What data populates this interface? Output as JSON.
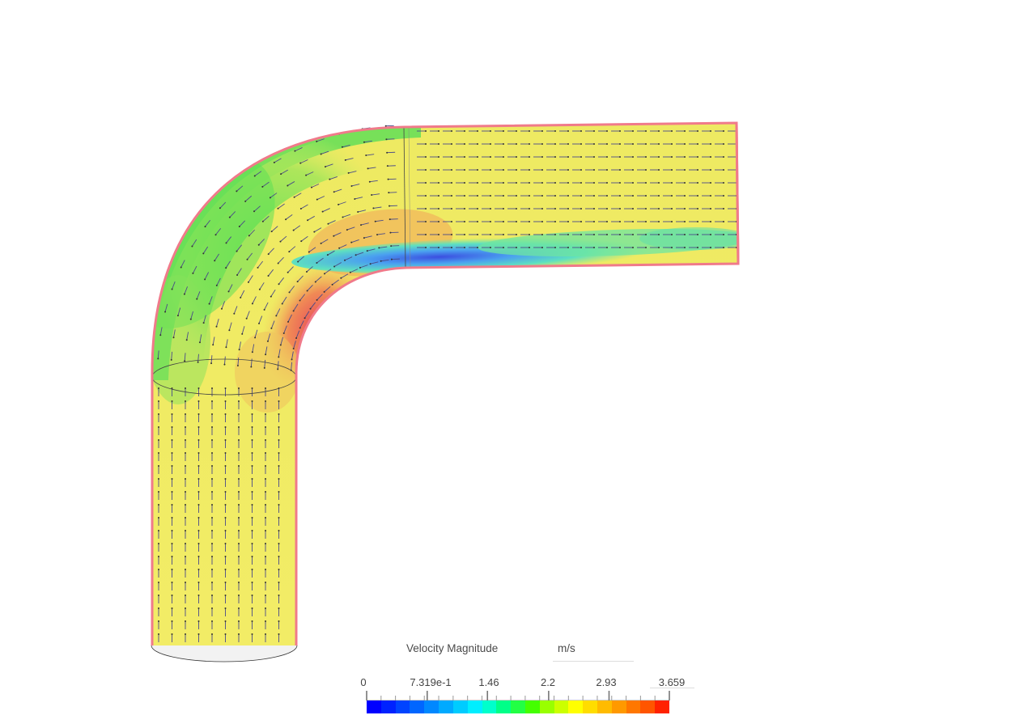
{
  "scene": {
    "field": "Velocity Magnitude",
    "object": "pipe-elbow-90deg",
    "contour_colors": {
      "bulk": "#f0ec62",
      "outer_wall_low": "#6ee05a",
      "inner_corner_high": "#ee5a5a",
      "separation_zone": "#4a5ee6",
      "wall_edge": "#f07a8a",
      "vector_arrows": "#4a4a8a"
    }
  },
  "legend": {
    "title": "Velocity Magnitude",
    "unit": "m/s",
    "min": 0,
    "max": 3.659,
    "tick_labels": [
      "0",
      "7.319e-1",
      "1.46",
      "2.2",
      "2.93",
      "3.659"
    ],
    "tick_values": [
      0,
      0.7319,
      1.46,
      2.2,
      2.93,
      3.659
    ],
    "colors": [
      "#0000ff",
      "#0022ff",
      "#0044ff",
      "#0066ff",
      "#0088ff",
      "#00aaff",
      "#00ccff",
      "#00eeff",
      "#00ffcc",
      "#00ff88",
      "#22ff44",
      "#44ff00",
      "#99ff00",
      "#ccff00",
      "#ffff00",
      "#ffdd00",
      "#ffbb00",
      "#ff9900",
      "#ff7700",
      "#ff5500",
      "#ff2200"
    ]
  }
}
